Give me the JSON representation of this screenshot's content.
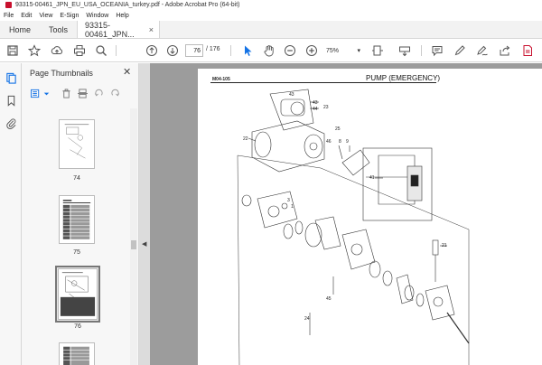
{
  "window": {
    "title": "93315-00461_JPN_EU_USA_OCEANIA_turkey.pdf - Adobe Acrobat Pro (64-bit)"
  },
  "menu": [
    "File",
    "Edit",
    "View",
    "E-Sign",
    "Window",
    "Help"
  ],
  "tabs": {
    "home": "Home",
    "tools": "Tools",
    "document": "93315-00461_JPN...",
    "close_glyph": "×"
  },
  "toolbar": {
    "current_page": "76",
    "page_total": "/ 176",
    "zoom": "75%",
    "zoom_caret": "▾"
  },
  "thumbnails": {
    "title": "Page Thumbnails",
    "close_glyph": "✕",
    "collapse_glyph": "◀",
    "pages": [
      {
        "label": "74",
        "selected": false
      },
      {
        "label": "75",
        "selected": false
      },
      {
        "label": "76",
        "selected": true
      },
      {
        "label": "",
        "selected": false
      }
    ]
  },
  "document": {
    "code": "M04-105",
    "heading": "PUMP (EMERGENCY)",
    "callouts": [
      "43",
      "43",
      "44",
      "23",
      "22",
      "25",
      "46",
      "8",
      "9",
      "41",
      "21",
      "45",
      "24",
      "3",
      "1"
    ]
  },
  "icons": {
    "rail": [
      "pages-icon",
      "bookmark-icon",
      "attachment-icon"
    ],
    "colors": {
      "accent": "#c8102e",
      "link_blue": "#1473e6"
    }
  }
}
